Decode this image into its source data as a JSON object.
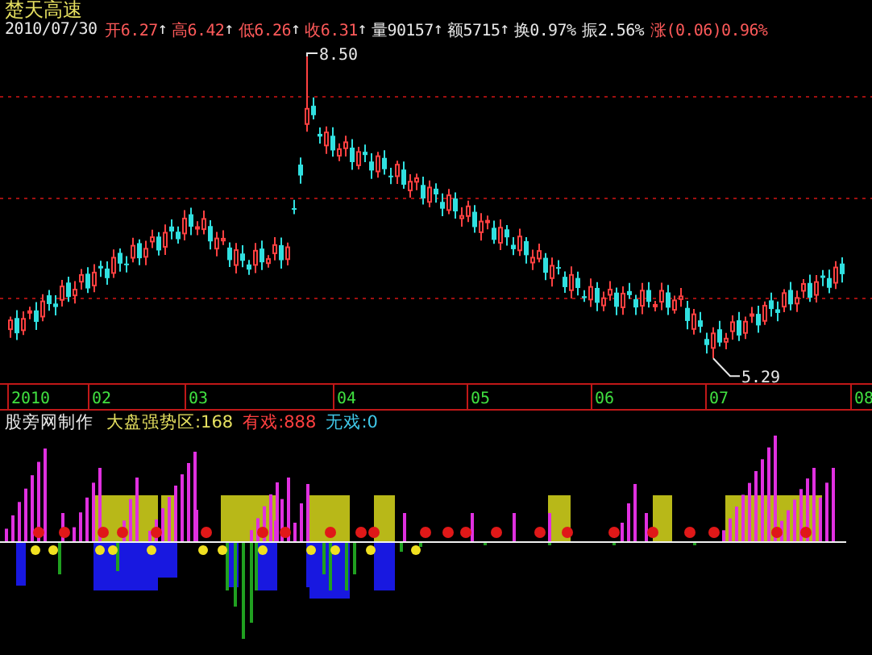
{
  "stock": {
    "name": "楚天高速"
  },
  "quote": {
    "date": "2010/07/30",
    "fields": [
      {
        "text": "开6.27",
        "arrow": "↑",
        "color": "#ff5a5a"
      },
      {
        "text": "高6.42",
        "arrow": "↑",
        "color": "#ff5a5a"
      },
      {
        "text": "低6.26",
        "arrow": "↑",
        "color": "#ff5a5a"
      },
      {
        "text": "收6.31",
        "arrow": "↑",
        "color": "#ff5a5a"
      },
      {
        "text": "量90157",
        "arrow": "↑",
        "color": "#e8e8e8"
      },
      {
        "text": "额5715",
        "arrow": "↑",
        "color": "#e8e8e8"
      },
      {
        "text": "换0.97%",
        "color": "#e8e8e8"
      },
      {
        "text": "振2.56%",
        "color": "#e8e8e8"
      },
      {
        "text": "涨(0.06)0.96%",
        "color": "#ff5a5a"
      }
    ]
  },
  "price_chart": {
    "high_label": "8.50",
    "low_label": "5.29"
  },
  "time_axis": {
    "labels": [
      "2010",
      "02",
      "03",
      "04",
      "05",
      "06",
      "07",
      "08"
    ]
  },
  "indicator": {
    "title": "股旁网制作",
    "items": [
      {
        "text": "大盘强势区:168",
        "color": "#e6e060"
      },
      {
        "text": "有戏:888",
        "color": "#ff4040"
      },
      {
        "text": "无戏:0",
        "color": "#40c8e8"
      }
    ]
  }
}
